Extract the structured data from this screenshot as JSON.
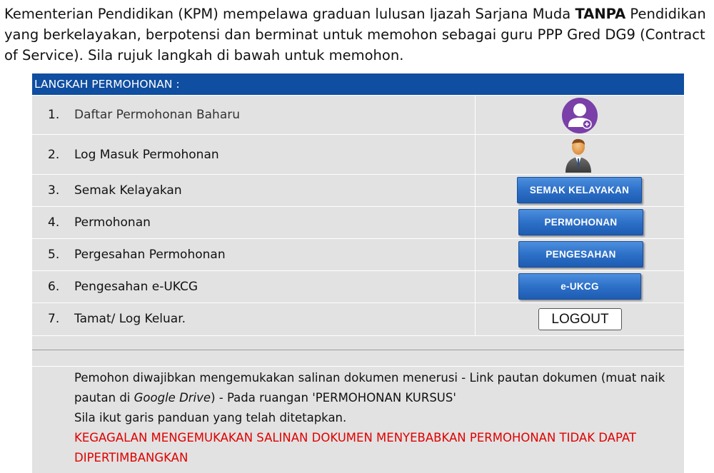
{
  "intro": {
    "text_before_bold": "Kementerian Pendidikan (KPM) mempelawa graduan lulusan Ijazah Sarjana Muda ",
    "bold_text": "TANPA",
    "text_after_bold": " Pendidikan yang berkelayakan, berpotensi dan berminat untuk memohon sebagai guru PPP Gred DG9 (Contract of Service). Sila rujuk langkah di bawah untuk memohon."
  },
  "panel": {
    "header": "LANGKAH PERMOHONAN :",
    "steps": [
      {
        "num": "1.",
        "label": "Daftar Permohonan Baharu",
        "action_icon": "new-user-icon"
      },
      {
        "num": "2.",
        "label": "Log Masuk Permohonan",
        "action_icon": "user-login-icon"
      },
      {
        "num": "3.",
        "label": "Semak Kelayakan",
        "action_label": "SEMAK KELAYAKAN"
      },
      {
        "num": "4.",
        "label": "Permohonan",
        "action_label": "PERMOHONAN"
      },
      {
        "num": "5.",
        "label": "Pergesahan Permohonan",
        "action_label": "PENGESAHAN"
      },
      {
        "num": "6.",
        "label": "Pengesahan e-UKCG",
        "action_label": "e-UKCG"
      },
      {
        "num": "7.",
        "label": "Tamat/ Log Keluar.",
        "action_label": "LOGOUT"
      }
    ],
    "notice": {
      "line1_before": "Pemohon diwajibkan mengemukakan salinan dokumen menerusi - Link pautan dokumen (muat naik pautan di ",
      "line1_italic": "Google Drive",
      "line1_after": ") - Pada ruangan 'PERMOHONAN KURSUS'",
      "line2": "Sila ikut garis panduan yang telah ditetapkan.",
      "warning": "KEGAGALAN MENGEMUKAKAN SALINAN DOKUMEN MENYEBABKAN PERMOHONAN TIDAK DAPAT DIPERTIMBANGKAN"
    }
  },
  "colors": {
    "header_bg": "#0f4ea0",
    "panel_bg": "#e2e2e2",
    "button_blue": "#2d70c8",
    "warning_red": "#e00000",
    "avatar_purple": "#7a3fa8"
  }
}
